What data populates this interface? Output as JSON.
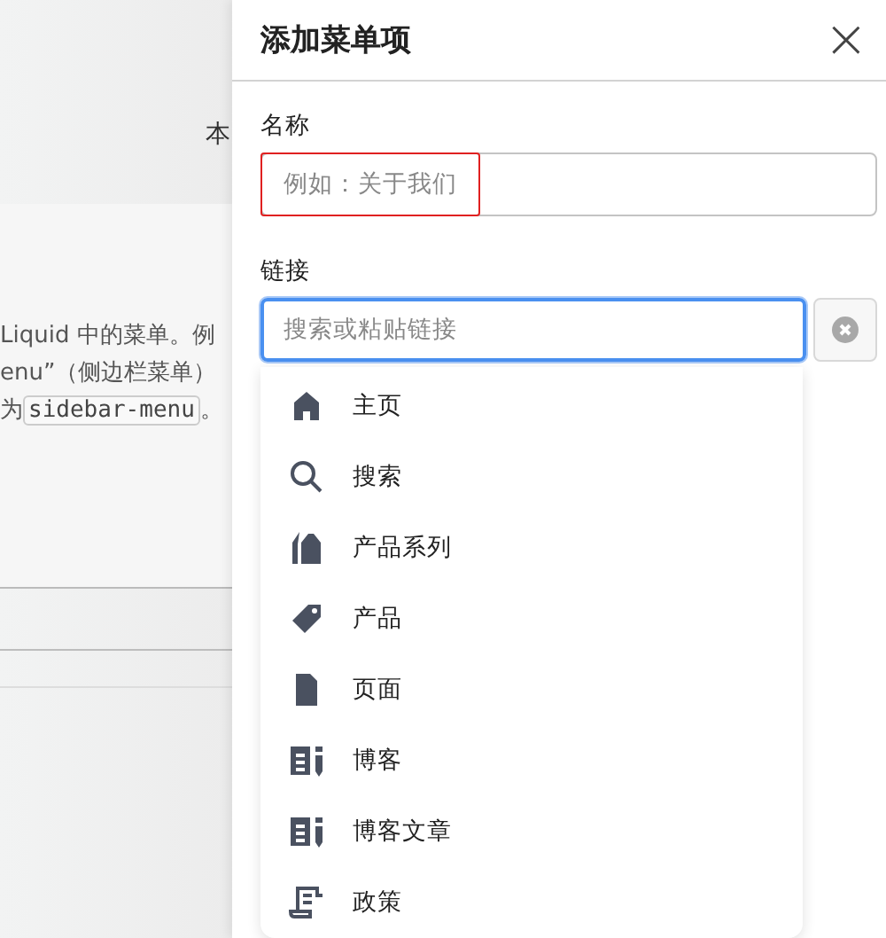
{
  "background_page": {
    "heading_fragment": "本",
    "description_lines": [
      "Liquid 中的菜单。例",
      "enu”（侧边栏菜单）"
    ],
    "handle_prefix": "为",
    "handle_code": "sidebar-menu",
    "handle_suffix": "。"
  },
  "drawer": {
    "title": "添加菜单项",
    "close": "×",
    "name_field": {
      "label": "名称",
      "placeholder": "例如：关于我们",
      "error": true
    },
    "link_field": {
      "label": "链接",
      "placeholder": "搜索或粘贴链接",
      "focused": true
    },
    "suggestions": [
      {
        "kind": "home",
        "label": "主页"
      },
      {
        "kind": "search",
        "label": "搜索"
      },
      {
        "kind": "collection",
        "label": "产品系列"
      },
      {
        "kind": "product",
        "label": "产品"
      },
      {
        "kind": "page",
        "label": "页面"
      },
      {
        "kind": "blog",
        "label": "博客"
      },
      {
        "kind": "blog",
        "label": "博客文章"
      },
      {
        "kind": "policy",
        "label": "政策"
      }
    ]
  }
}
